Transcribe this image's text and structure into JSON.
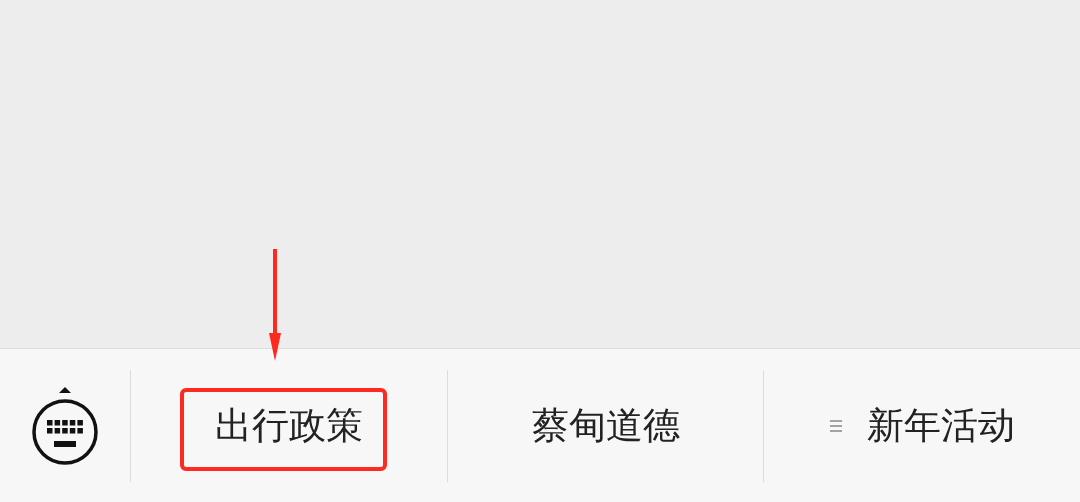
{
  "menu_bar": {
    "items": [
      {
        "label": "出行政策",
        "kind": "plain",
        "highlighted": true
      },
      {
        "label": "蔡甸道德",
        "kind": "plain",
        "highlighted": false
      },
      {
        "label": "新年活动",
        "kind": "submenu",
        "highlighted": false
      }
    ]
  }
}
